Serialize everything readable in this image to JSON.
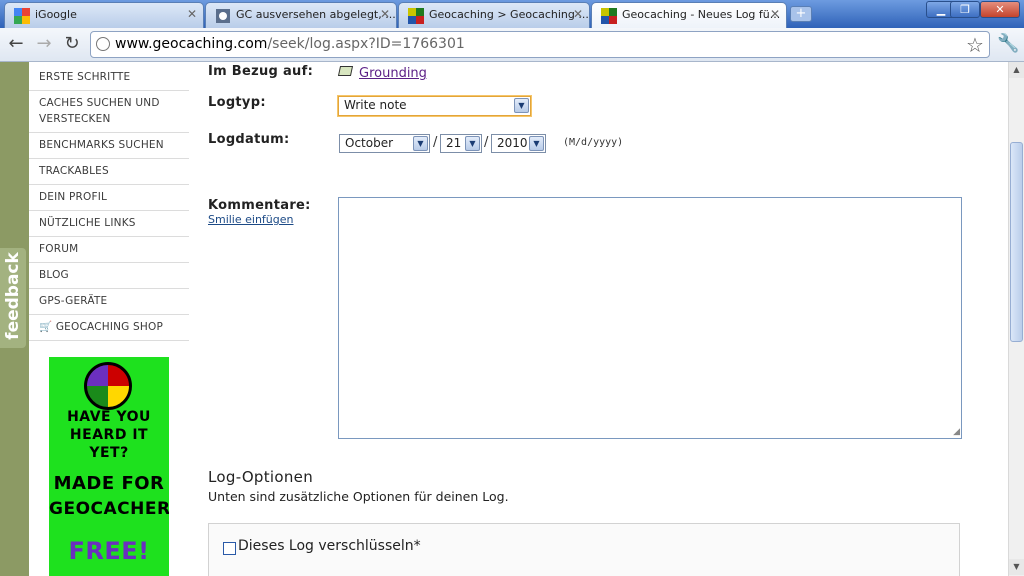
{
  "tabs": [
    {
      "title": "iGoogle"
    },
    {
      "title": "GC ausversehen abgelegt, ..."
    },
    {
      "title": "Geocaching > Geocaching ..."
    },
    {
      "title": "Geocaching - Neues Log fü..."
    }
  ],
  "window_buttons": {
    "minimize": "▁",
    "maximize": "❐",
    "close": "✕"
  },
  "address": {
    "host": "www.geocaching.com",
    "path": "/seek/log.aspx?ID=1766301"
  },
  "sidebar": {
    "items": [
      {
        "label": "ERSTE SCHRITTE"
      },
      {
        "label": "CACHES SUCHEN UND VERSTECKEN"
      },
      {
        "label": "BENCHMARKS SUCHEN"
      },
      {
        "label": "TRACKABLES"
      },
      {
        "label": "DEIN PROFIL"
      },
      {
        "label": "NÜTZLICHE LINKS"
      },
      {
        "label": "FORUM"
      },
      {
        "label": "BLOG"
      },
      {
        "label": "GPS-GERÄTE"
      },
      {
        "label": "GEOCACHING SHOP"
      }
    ],
    "feedback": "feedback",
    "ad": {
      "line1": "HAVE YOU",
      "line2": "HEARD IT",
      "line3": "YET?",
      "line4": "MADE FOR",
      "line5": "GEOCACHERS",
      "line6": "FREE!"
    }
  },
  "form": {
    "bezug_label": "Im Bezug auf:",
    "bezug_link": "Grounding",
    "logtyp_label": "Logtyp:",
    "logtyp_value": "Write note",
    "logdatum_label": "Logdatum:",
    "month": "October",
    "day": "21",
    "year": "2010",
    "date_sep": "/",
    "date_format": "(M/d/yyyy)",
    "kommentare_label": "Kommentare:",
    "smilie_link": "Smilie einfügen",
    "options_heading": "Log-Optionen",
    "options_sub": "Unten sind zusätzliche Optionen für deinen Log.",
    "encrypt_label": "Dieses Log verschlüsseln*"
  }
}
